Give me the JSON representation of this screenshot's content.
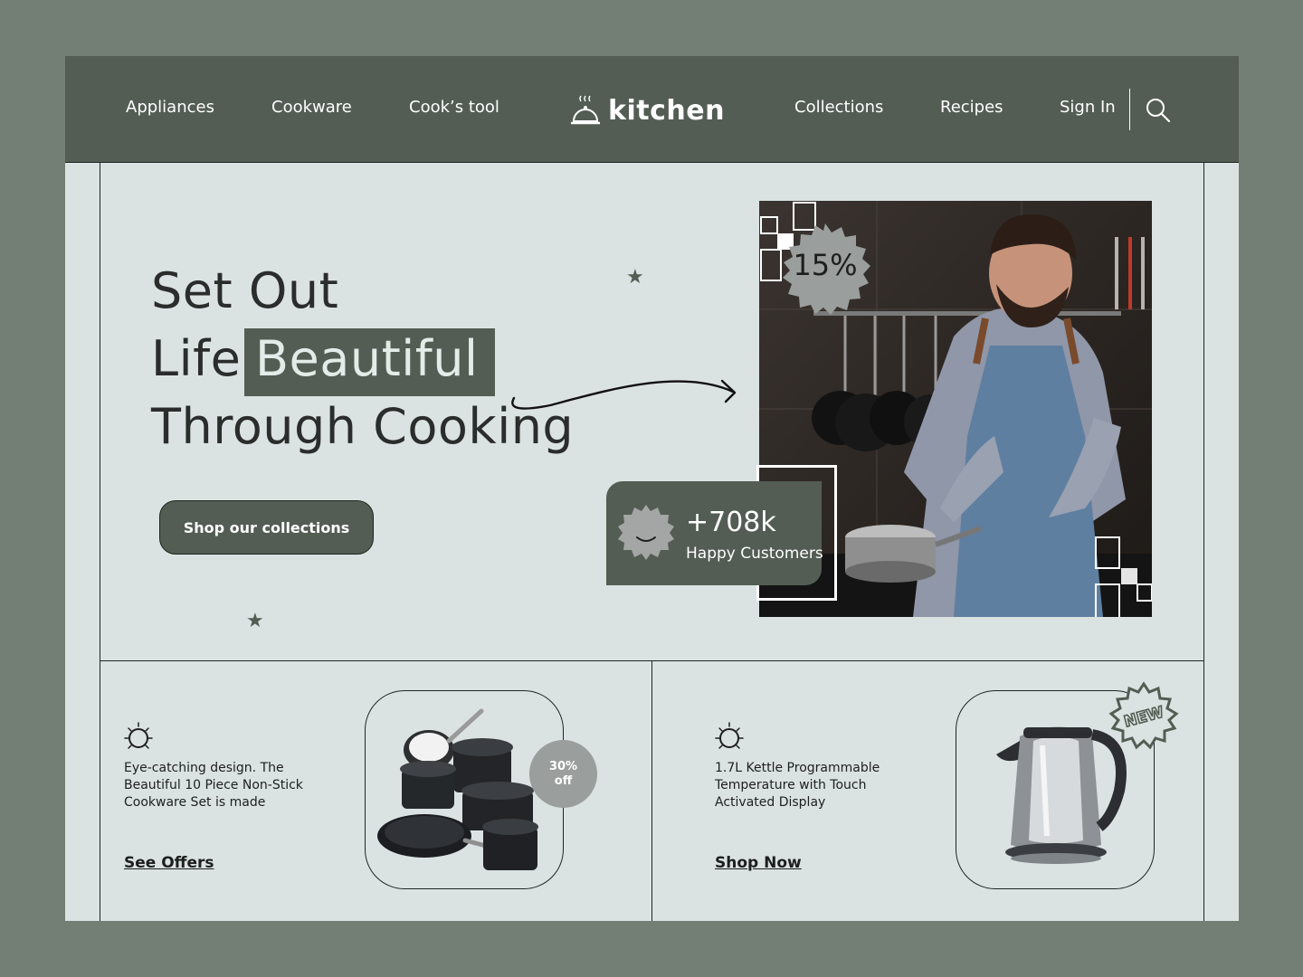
{
  "header": {
    "nav_left": [
      "Appliances",
      "Cookware",
      "Cook’s tool"
    ],
    "brand": "kitchen",
    "nav_right": [
      "Collections",
      "Recipes",
      "Sign In"
    ]
  },
  "hero": {
    "line1": "Set Out",
    "line2_plain": "Life",
    "line2_highlight": "Beautiful",
    "line3": "Through Cooking",
    "cta_label": "Shop our collections"
  },
  "photo_badge": {
    "discount": "15%"
  },
  "stats": {
    "value": "+708k",
    "label": "Happy Customers"
  },
  "products": [
    {
      "description": "Eye-catching design. The Beautiful 10 Piece Non-Stick Cookware Set is made",
      "link": "See Offers",
      "badge_line1": "30%",
      "badge_line2": "off"
    },
    {
      "description": "1.7L Kettle Programmable Temperature with Touch Activated Display",
      "link": "Shop Now",
      "badge": "NEW"
    }
  ],
  "colors": {
    "outer_bg": "#737f74",
    "panel_bg": "#dbe3e2",
    "accent": "#535d54",
    "badge_gray": "#9a9e9c"
  }
}
